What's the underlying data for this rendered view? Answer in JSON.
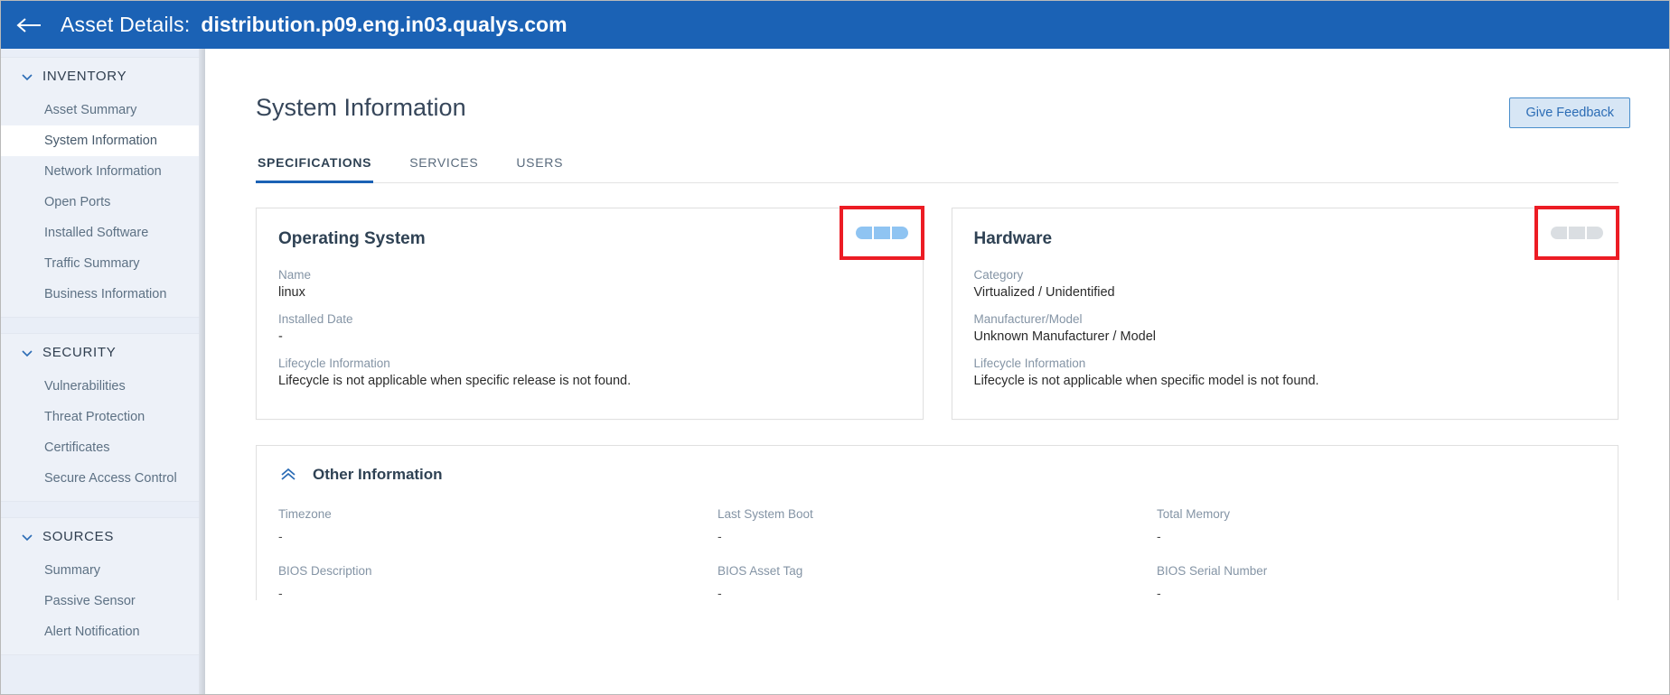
{
  "header": {
    "back_icon": "arrow-left-icon",
    "title": "Asset Details:",
    "asset_name": "distribution.p09.eng.in03.qualys.com",
    "background_color": "#1b62b5"
  },
  "sidebar": {
    "groups": [
      {
        "label": "INVENTORY",
        "chevron": "chevron-down-icon",
        "items": [
          {
            "label": "Asset Summary",
            "active": false
          },
          {
            "label": "System Information",
            "active": true
          },
          {
            "label": "Network Information",
            "active": false
          },
          {
            "label": "Open Ports",
            "active": false
          },
          {
            "label": "Installed Software",
            "active": false
          },
          {
            "label": "Traffic Summary",
            "active": false
          },
          {
            "label": "Business Information",
            "active": false
          }
        ]
      },
      {
        "label": "SECURITY",
        "chevron": "chevron-down-icon",
        "items": [
          {
            "label": "Vulnerabilities",
            "active": false
          },
          {
            "label": "Threat Protection",
            "active": false
          },
          {
            "label": "Certificates",
            "active": false
          },
          {
            "label": "Secure Access Control",
            "active": false
          }
        ]
      },
      {
        "label": "SOURCES",
        "chevron": "chevron-down-icon",
        "items": [
          {
            "label": "Summary",
            "active": false
          },
          {
            "label": "Passive Sensor",
            "active": false
          },
          {
            "label": "Alert Notification",
            "active": false
          }
        ]
      }
    ]
  },
  "main": {
    "page_title": "System Information",
    "feedback_button": "Give Feedback",
    "tabs": [
      {
        "label": "SPECIFICATIONS",
        "active": true
      },
      {
        "label": "SERVICES",
        "active": false
      },
      {
        "label": "USERS",
        "active": false
      }
    ],
    "cards": [
      {
        "title": "Operating System",
        "badge_style": "blue",
        "annotated": true,
        "fields": [
          {
            "label": "Name",
            "value": "linux"
          },
          {
            "label": "Installed Date",
            "value": "-"
          },
          {
            "label": "Lifecycle Information",
            "value": "Lifecycle is not applicable when specific release is not found."
          }
        ]
      },
      {
        "title": "Hardware",
        "badge_style": "gray",
        "annotated": true,
        "fields": [
          {
            "label": "Category",
            "value": "Virtualized / Unidentified"
          },
          {
            "label": "Manufacturer/Model",
            "value": "Unknown Manufacturer / Model"
          },
          {
            "label": "Lifecycle Information",
            "value": "Lifecycle is not applicable when specific model is not found."
          }
        ]
      }
    ],
    "other_information": {
      "title": "Other Information",
      "collapse_icon": "chevron-up-double-icon",
      "fields": [
        {
          "label": "Timezone",
          "value": "-"
        },
        {
          "label": "Last System Boot",
          "value": "-"
        },
        {
          "label": "Total Memory",
          "value": "-"
        },
        {
          "label": "BIOS Description",
          "value": "-"
        },
        {
          "label": "BIOS Asset Tag",
          "value": "-"
        },
        {
          "label": "BIOS Serial Number",
          "value": "-"
        }
      ]
    }
  },
  "colors": {
    "header_blue": "#1b62b5",
    "accent_blue": "#2b6cb5",
    "annotation_red": "#ec1c24",
    "badge_blue": "#8fc4f2",
    "badge_gray": "#dadee2",
    "sidebar_bg": "#e9eef7"
  }
}
